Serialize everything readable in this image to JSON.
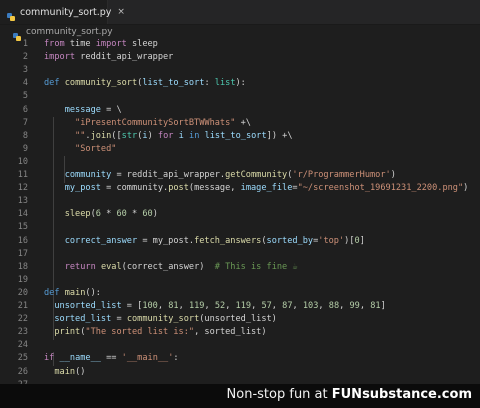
{
  "tab": {
    "label": "community_sort.py",
    "close": "×"
  },
  "breadcrumb": {
    "label": "community_sort.py"
  },
  "lines": [
    {
      "n": "1",
      "tokens": [
        [
          "from",
          "t-kw"
        ],
        [
          " time ",
          "t-op"
        ],
        [
          "import",
          "t-kw"
        ],
        [
          " sleep",
          "t-op"
        ]
      ]
    },
    {
      "n": "2",
      "tokens": [
        [
          "import",
          "t-kw"
        ],
        [
          " reddit_api_wrapper",
          "t-op"
        ]
      ]
    },
    {
      "n": "3",
      "tokens": []
    },
    {
      "n": "4",
      "tokens": [
        [
          "def",
          "t-blue"
        ],
        [
          " ",
          "t-op"
        ],
        [
          "community_sort",
          "t-fn"
        ],
        [
          "(",
          "t-op"
        ],
        [
          "list_to_sort",
          "t-var"
        ],
        [
          ": ",
          "t-op"
        ],
        [
          "list",
          "t-cls"
        ],
        [
          "):",
          "t-op"
        ]
      ]
    },
    {
      "n": "5",
      "tokens": []
    },
    {
      "n": "6",
      "tokens": [
        [
          "    ",
          "t-op"
        ],
        [
          "message",
          "t-var"
        ],
        [
          " = \\",
          "t-op"
        ]
      ]
    },
    {
      "n": "7",
      "tokens": [
        [
          "      ",
          "t-op"
        ],
        [
          "\"iPresentCommunitySortBTWWhats\"",
          "t-str"
        ],
        [
          " +\\",
          "t-op"
        ]
      ]
    },
    {
      "n": "8",
      "tokens": [
        [
          "      ",
          "t-op"
        ],
        [
          "\"\"",
          "t-str"
        ],
        [
          ".",
          "t-op"
        ],
        [
          "join",
          "t-fn"
        ],
        [
          "([",
          "t-op"
        ],
        [
          "str",
          "t-cls"
        ],
        [
          "(",
          "t-op"
        ],
        [
          "i",
          "t-var"
        ],
        [
          ") ",
          "t-op"
        ],
        [
          "for",
          "t-kw"
        ],
        [
          " ",
          "t-op"
        ],
        [
          "i",
          "t-var"
        ],
        [
          " ",
          "t-op"
        ],
        [
          "in",
          "t-blue"
        ],
        [
          " ",
          "t-op"
        ],
        [
          "list_to_sort",
          "t-var"
        ],
        [
          "]) +\\",
          "t-op"
        ]
      ]
    },
    {
      "n": "9",
      "tokens": [
        [
          "      ",
          "t-op"
        ],
        [
          "\"Sorted\"",
          "t-str"
        ]
      ]
    },
    {
      "n": "10",
      "tokens": []
    },
    {
      "n": "11",
      "tokens": [
        [
          "    ",
          "t-op"
        ],
        [
          "community",
          "t-var"
        ],
        [
          " = reddit_api_wrapper.",
          "t-op"
        ],
        [
          "getCommunity",
          "t-fn"
        ],
        [
          "(",
          "t-op"
        ],
        [
          "'r/ProgrammerHumor'",
          "t-str"
        ],
        [
          ")",
          "t-op"
        ]
      ]
    },
    {
      "n": "12",
      "tokens": [
        [
          "    ",
          "t-op"
        ],
        [
          "my_post",
          "t-var"
        ],
        [
          " = community.",
          "t-op"
        ],
        [
          "post",
          "t-fn"
        ],
        [
          "(message, ",
          "t-op"
        ],
        [
          "image_file",
          "t-var"
        ],
        [
          "=",
          "t-op"
        ],
        [
          "\"~/screenshot_19691231_2200.png\"",
          "t-str"
        ],
        [
          ")",
          "t-op"
        ]
      ]
    },
    {
      "n": "13",
      "tokens": []
    },
    {
      "n": "14",
      "tokens": [
        [
          "    ",
          "t-op"
        ],
        [
          "sleep",
          "t-fn"
        ],
        [
          "(",
          "t-op"
        ],
        [
          "6",
          "t-num"
        ],
        [
          " * ",
          "t-op"
        ],
        [
          "60",
          "t-num"
        ],
        [
          " * ",
          "t-op"
        ],
        [
          "60",
          "t-num"
        ],
        [
          ")",
          "t-op"
        ]
      ]
    },
    {
      "n": "15",
      "tokens": []
    },
    {
      "n": "16",
      "tokens": [
        [
          "    ",
          "t-op"
        ],
        [
          "correct_answer",
          "t-var"
        ],
        [
          " = my_post.",
          "t-op"
        ],
        [
          "fetch_answers",
          "t-fn"
        ],
        [
          "(",
          "t-op"
        ],
        [
          "sorted_by",
          "t-var"
        ],
        [
          "=",
          "t-op"
        ],
        [
          "'top'",
          "t-str"
        ],
        [
          ")[",
          "t-op"
        ],
        [
          "0",
          "t-num"
        ],
        [
          "]",
          "t-op"
        ]
      ]
    },
    {
      "n": "17",
      "tokens": []
    },
    {
      "n": "18",
      "tokens": [
        [
          "    ",
          "t-op"
        ],
        [
          "return",
          "t-kw"
        ],
        [
          " ",
          "t-op"
        ],
        [
          "eval",
          "t-fn"
        ],
        [
          "(correct_answer)  ",
          "t-op"
        ],
        [
          "# This is fine ☕",
          "t-cmt"
        ]
      ]
    },
    {
      "n": "19",
      "tokens": []
    },
    {
      "n": "20",
      "tokens": [
        [
          "def",
          "t-blue"
        ],
        [
          " ",
          "t-op"
        ],
        [
          "main",
          "t-fn"
        ],
        [
          "():",
          "t-op"
        ]
      ]
    },
    {
      "n": "21",
      "tokens": [
        [
          "  ",
          "t-op"
        ],
        [
          "unsorted_list",
          "t-var"
        ],
        [
          " = [",
          "t-op"
        ],
        [
          "100",
          "t-num"
        ],
        [
          ", ",
          "t-op"
        ],
        [
          "81",
          "t-num"
        ],
        [
          ", ",
          "t-op"
        ],
        [
          "119",
          "t-num"
        ],
        [
          ", ",
          "t-op"
        ],
        [
          "52",
          "t-num"
        ],
        [
          ", ",
          "t-op"
        ],
        [
          "119",
          "t-num"
        ],
        [
          ", ",
          "t-op"
        ],
        [
          "57",
          "t-num"
        ],
        [
          ", ",
          "t-op"
        ],
        [
          "87",
          "t-num"
        ],
        [
          ", ",
          "t-op"
        ],
        [
          "103",
          "t-num"
        ],
        [
          ", ",
          "t-op"
        ],
        [
          "88",
          "t-num"
        ],
        [
          ", ",
          "t-op"
        ],
        [
          "99",
          "t-num"
        ],
        [
          ", ",
          "t-op"
        ],
        [
          "81",
          "t-num"
        ],
        [
          "]",
          "t-op"
        ]
      ]
    },
    {
      "n": "22",
      "tokens": [
        [
          "  ",
          "t-op"
        ],
        [
          "sorted_list",
          "t-var"
        ],
        [
          " = ",
          "t-op"
        ],
        [
          "community_sort",
          "t-fn"
        ],
        [
          "(unsorted_list)",
          "t-op"
        ]
      ]
    },
    {
      "n": "23",
      "tokens": [
        [
          "  ",
          "t-op"
        ],
        [
          "print",
          "t-fn"
        ],
        [
          "(",
          "t-op"
        ],
        [
          "\"The sorted list is:\"",
          "t-str"
        ],
        [
          ", sorted_list)",
          "t-op"
        ]
      ]
    },
    {
      "n": "24",
      "tokens": []
    },
    {
      "n": "25",
      "tokens": [
        [
          "if",
          "t-kw"
        ],
        [
          " ",
          "t-op"
        ],
        [
          "__name__",
          "t-var"
        ],
        [
          " == ",
          "t-op"
        ],
        [
          "'__main__'",
          "t-str"
        ],
        [
          ":",
          "t-op"
        ]
      ]
    },
    {
      "n": "26",
      "tokens": [
        [
          "  ",
          "t-op"
        ],
        [
          "main",
          "t-fn"
        ],
        [
          "()",
          "t-op"
        ]
      ]
    },
    {
      "n": "27",
      "tokens": []
    }
  ],
  "banner": {
    "prefix": "Non-stop fun at ",
    "brand": "FUNsubstance.com"
  },
  "colors": {
    "editor_bg": "#1e1e1e",
    "keyword": "#c586c0",
    "function": "#dcdcaa",
    "string": "#ce9178",
    "number": "#b5cea8",
    "comment": "#6a9955"
  }
}
